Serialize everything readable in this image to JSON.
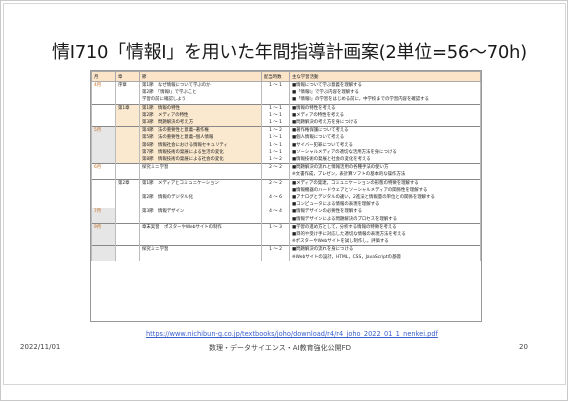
{
  "slide": {
    "title": "情Ⅰ710「情報Ⅰ」を用いた年間指導計画案(2単位=56～70h)",
    "url": "https://www.nichibun-g.co.jp/textbooks/joho/download/r4/r4_joho_2022_01_1_nenkei.pdf",
    "date": "2022/11/01",
    "center": "数理・データサイエンス・AI教育強化公開FD",
    "page": "20"
  },
  "table": {
    "headers": [
      "月",
      "章",
      "節",
      "配当時数",
      "主な学習活動"
    ],
    "rows": [
      {
        "month": "4月",
        "chapter": "序章",
        "section": "第1節　なぜ情報について学ぶのか",
        "hours": "1 ～ 1",
        "activity": "■情報について学ぶ意義を理解する"
      },
      {
        "month": "",
        "chapter": "",
        "section": "第2節　「情報Ⅰ」で学ぶこと",
        "hours": "",
        "activity": "■「情報Ⅰ」で学ぶ内容を理解する"
      },
      {
        "month": "",
        "chapter": "",
        "section": "学習の前に確認しよう",
        "hours": "",
        "activity": "■「情報Ⅰ」の学習をはじめる前に，中学校までの学習内容を確認する"
      },
      {
        "month": "",
        "chapter": "第1章",
        "section": "第1節　情報の特性",
        "hours": "1 ～ 1",
        "activity": "■情報の特性を考える",
        "sep": true,
        "hi": true
      },
      {
        "month": "",
        "chapter": "",
        "section": "第2節　メディアの特性",
        "hours": "1 ～ 1",
        "activity": "■メディアの特性を考える",
        "hi": true
      },
      {
        "month": "",
        "chapter": "",
        "section": "第3節　問題解決の考え方",
        "hours": "1 ～ 1",
        "activity": "■問題解決の考え方を身につける",
        "hi": true
      },
      {
        "month": "5月",
        "chapter": "",
        "section": "第4節　法の重要性と意義─著作権",
        "hours": "1 ～ 2",
        "activity": "■著作権保護について考える",
        "sep": true,
        "hi": true,
        "shade": true
      },
      {
        "month": "",
        "chapter": "",
        "section": "第5節　法の重要性と意義─個人情報",
        "hours": "1 ～ 1",
        "activity": "■個人情報について考える",
        "hi": true,
        "shade": true
      },
      {
        "month": "",
        "chapter": "",
        "section": "第6節　情報社会における情報セキュリティ",
        "hours": "1 ～ 1",
        "activity": "■サイバー犯罪について考える",
        "hi": true,
        "shade": true
      },
      {
        "month": "",
        "chapter": "",
        "section": "第7節　情報技術の発展による生活の変化",
        "hours": "1 ～ 1",
        "activity": "■ソーシャルメディアの適切な活用方法を身につける",
        "hi": true,
        "shade": true
      },
      {
        "month": "",
        "chapter": "",
        "section": "第8節　情報技術の発展による社会の変化",
        "hours": "1 ～ 2",
        "activity": "■情報技術の発展と社会の変化を考える",
        "hi": true,
        "shade": true
      },
      {
        "month": "6月",
        "chapter": "",
        "section": "探究ミニ学習",
        "hours": "2 ～ 2",
        "activity": "■問題解決の流れと情報活用の各種手法の使い方",
        "sep": true
      },
      {
        "month": "",
        "chapter": "",
        "section": "",
        "hours": "",
        "activity": "※文書作成，プレゼン，表計算ソフトの基本的な操作方法"
      },
      {
        "month": "",
        "chapter": "第2章",
        "section": "第1節　メディアとコミュニケーション",
        "hours": "2 ～ 2",
        "activity": "■メディアの発達，コミュニケーションの形態の特徴を理解する",
        "sep": true
      },
      {
        "month": "",
        "chapter": "",
        "section": "",
        "hours": "",
        "activity": "■情報機器のハードウェアとソーシャルメディアの関係性を理解する"
      },
      {
        "month": "",
        "chapter": "",
        "section": "第2節　情報のデジタル化",
        "hours": "4 ～ 6",
        "activity": "■アナログとデジタルの違い，2進法と情報量の単位との関係を理解する"
      },
      {
        "month": "",
        "chapter": "",
        "section": "",
        "hours": "",
        "activity": "■コンピュータによる情報の表現を理解する"
      },
      {
        "month": "7月",
        "chapter": "",
        "section": "第3節　情報デザイン",
        "hours": "4 ～ 4",
        "activity": "■情報デザインの必要性を理解する",
        "shade": true
      },
      {
        "month": "",
        "chapter": "",
        "section": "",
        "hours": "",
        "activity": "■情報デザインによる問題解決のプロセスを理解する",
        "shade": true
      },
      {
        "month": "9月",
        "chapter": "",
        "section": "章末実習　ポスターやWebサイトの制作",
        "hours": "1 ～ 3",
        "activity": "■学習の進め方として，分析する情報の特徴を考える",
        "sep": true,
        "shade": true
      },
      {
        "month": "",
        "chapter": "",
        "section": "",
        "hours": "",
        "activity": "■目的や受け手に対応した適切な情報の表現方法を考える",
        "shade": true
      },
      {
        "month": "",
        "chapter": "",
        "section": "",
        "hours": "",
        "activity": "※ポスターやWebサイトを試し制作し，評価する",
        "shade": true
      },
      {
        "month": "",
        "chapter": "",
        "section": "探究ミニ学習",
        "hours": "1 ～ 2",
        "activity": "■問題解決の流れを身につける",
        "sep": true,
        "shade": true
      },
      {
        "month": "",
        "chapter": "",
        "section": "",
        "hours": "",
        "activity": "※Webサイトの設計，HTML，CSS，JavaScriptの基礎",
        "shade": true
      }
    ]
  }
}
